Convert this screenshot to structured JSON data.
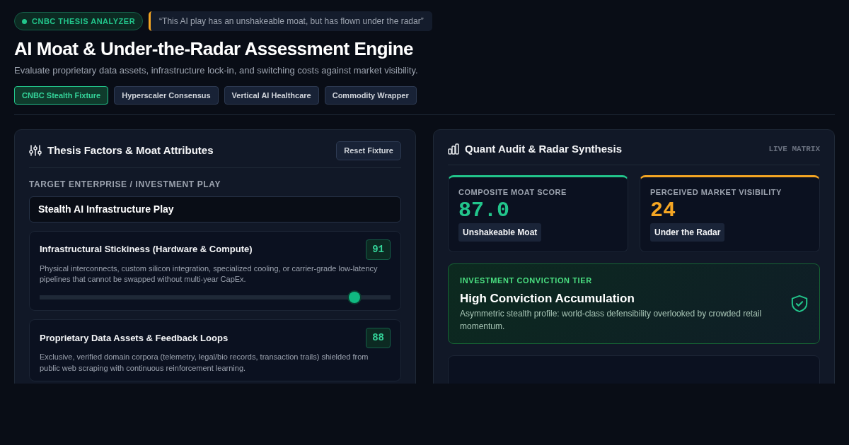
{
  "badge": {
    "label": "CNBC THESIS ANALYZER"
  },
  "quote": "“This AI play has an unshakeable moat, but has flown under the radar”",
  "title": "AI Moat & Under-the-Radar Assessment Engine",
  "subtitle": "Evaluate proprietary data assets, infrastructure lock-in, and switching costs against market visibility.",
  "presets": [
    {
      "label": "CNBC Stealth Fixture",
      "selected": true
    },
    {
      "label": "Hyperscaler Consensus",
      "selected": false
    },
    {
      "label": "Vertical AI Healthcare",
      "selected": false
    },
    {
      "label": "Commodity Wrapper",
      "selected": false
    }
  ],
  "left_panel": {
    "title": "Thesis Factors & Moat Attributes",
    "reset_button": "Reset Fixture",
    "field_label": "TARGET ENTERPRISE / INVESTMENT PLAY",
    "field_value": "Stealth AI Infrastructure Play",
    "factors": [
      {
        "name": "Infrastructural Stickiness (Hardware & Compute)",
        "score": "91",
        "description": "Physical interconnects, custom silicon integration, specialized cooling, or carrier-grade low-latency pipelines that cannot be swapped without multi-year CapEx.",
        "level": 0.91
      },
      {
        "name": "Proprietary Data Assets & Feedback Loops",
        "score": "88",
        "description": "Exclusive, verified domain corpora (telemetry, legal/bio records, transaction trails) shielded from public web scraping with continuous reinforcement learning."
      }
    ]
  },
  "right_panel": {
    "title": "Quant Audit & Radar Synthesis",
    "tag": "LIVE MATRIX",
    "metrics": [
      {
        "label": "COMPOSITE MOAT SCORE",
        "value": "87.0",
        "verdict": "Unshakeable Moat",
        "color": "#22c58b"
      },
      {
        "label": "PERCEIVED MARKET VISIBILITY",
        "value": "24",
        "verdict": "Under the Radar",
        "color": "#f5a623"
      }
    ],
    "tier": {
      "label": "INVESTMENT CONVICTION TIER",
      "title": "High Conviction Accumulation",
      "description": "Asymmetric stealth profile: world-class defensibility overlooked by crowded retail momentum."
    }
  }
}
